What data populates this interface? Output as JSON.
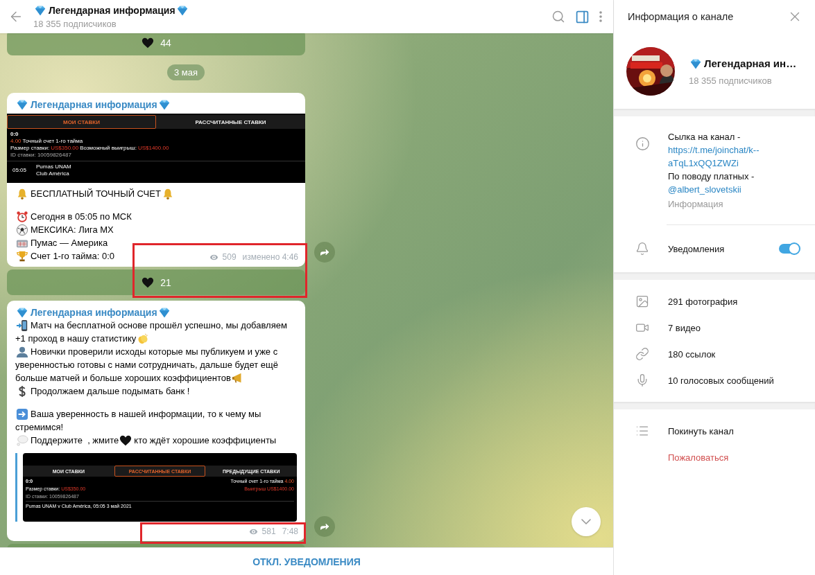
{
  "chat": {
    "title": "Легендарная информация",
    "subtitle": "18 355 подписчиков",
    "info_panel_selected": true,
    "items": [
      {
        "kind": "reactions",
        "count": "44"
      },
      {
        "kind": "date",
        "text": "3 мая"
      },
      {
        "kind": "message",
        "author": "Легендарная информация",
        "views": "509",
        "time": "изменено 4:46",
        "highlighted": true,
        "blocks": [
          {
            "kind": "screenshot",
            "tabs": [
              {
                "label": "МОИ СТАВКИ",
                "selected": true
              },
              {
                "label": "РАССЧИТАННЫЕ СТАВКИ",
                "selected": false
              }
            ],
            "score": "0:0",
            "odds": "4.00",
            "market": "Точный счет 1-го тайма",
            "stake_label": "Размер ставки:",
            "stake": "US$350.00",
            "payout_label": "Возможный выигрыш:",
            "payout": "US$1400.00",
            "bet_id": "ID ставки: 10059826487",
            "match_time": "05:05",
            "teams": [
              "Pumas UNAM",
              "Club América"
            ]
          },
          {
            "kind": "text",
            "lines": [
              {
                "parts": [
                  {
                    "kind": "emoji"
                  },
                  {
                    "kind": "text",
                    "text": "БЕСПЛАТНЫЙ ТОЧНЫЙ СЧЕТ"
                  },
                  {
                    "kind": "emoji"
                  }
                ]
              }
            ]
          },
          {
            "kind": "text",
            "lines": [
              {
                "parts": [
                  {
                    "kind": "emoji"
                  },
                  {
                    "kind": "text",
                    "text": "Сегодня в 05:05 по МСК"
                  }
                ]
              },
              {
                "parts": [
                  {
                    "kind": "emoji"
                  },
                  {
                    "kind": "text",
                    "text": "МЕКСИКА: Лига МХ"
                  }
                ]
              },
              {
                "parts": [
                  {
                    "kind": "emoji"
                  },
                  {
                    "kind": "text",
                    "text": "Пумас — Америка"
                  }
                ]
              },
              {
                "parts": [
                  {
                    "kind": "emoji"
                  },
                  {
                    "kind": "text",
                    "text": "Счет 1-го тайма: 0:0"
                  }
                ]
              }
            ]
          }
        ]
      },
      {
        "kind": "reactions",
        "count": "21"
      },
      {
        "kind": "message",
        "author": "Легендарная информация",
        "views": "581",
        "time": "7:48",
        "highlighted": true,
        "blocks": [
          {
            "kind": "text",
            "lines": [
              {
                "parts": [
                  {
                    "kind": "emoji"
                  },
                  {
                    "kind": "text",
                    "text": "Матч на бесплатной основе прошёл успешно, мы добавляем"
                  }
                ]
              },
              {
                "parts": [
                  {
                    "kind": "text",
                    "text": "+1 проход в нашу статистику"
                  },
                  {
                    "kind": "emoji"
                  }
                ]
              },
              {
                "parts": [
                  {
                    "kind": "emoji"
                  },
                  {
                    "kind": "text",
                    "text": "Новички проверили исходы которые мы публикуем и уже с"
                  }
                ]
              },
              {
                "parts": [
                  {
                    "kind": "text",
                    "text": "уверенностью готовы с нами сотрудничать, дальше будет ещё"
                  }
                ]
              },
              {
                "parts": [
                  {
                    "kind": "text",
                    "text": "больше матчей и больше хороших коэффициентов"
                  },
                  {
                    "kind": "emoji"
                  }
                ]
              },
              {
                "parts": [
                  {
                    "kind": "emoji"
                  },
                  {
                    "kind": "text",
                    "text": "Продолжаем дальше подымать банк !"
                  }
                ]
              }
            ]
          },
          {
            "kind": "text",
            "lines": [
              {
                "parts": [
                  {
                    "kind": "emoji"
                  },
                  {
                    "kind": "text",
                    "text": "Ваша уверенность в нашей информации, то к чему мы"
                  }
                ]
              },
              {
                "parts": [
                  {
                    "kind": "text",
                    "text": "стремимся!"
                  }
                ]
              },
              {
                "parts": [
                  {
                    "kind": "emoji"
                  },
                  {
                    "kind": "text",
                    "text": "Поддержите  , жмите"
                  },
                  {
                    "kind": "emoji"
                  },
                  {
                    "kind": "text",
                    "text": "кто ждёт хорошие коэффициенты"
                  }
                ]
              }
            ]
          },
          {
            "kind": "quoted_screenshot",
            "tabs": [
              {
                "label": "МОИ СТАВКИ",
                "selected": false
              },
              {
                "label": "РАССЧИТАННЫЕ СТАВКИ",
                "selected": true
              },
              {
                "label": "ПРЕДЫДУЩИЕ СТАВКИ",
                "selected": false
              }
            ],
            "score": "0:0",
            "stake_label": "Размер ставки:",
            "stake": "US$350.00",
            "bet_id": "ID ставки: 10059826487",
            "market": "Точный счет 1-го тайма",
            "odds": "4.00",
            "payout_label": "Выигрыш",
            "payout": "US$1400.00",
            "match": "Pumas UNAM v Club América, 05:05 3 май 2021"
          }
        ]
      },
      {
        "kind": "reactions"
      }
    ],
    "footer_button": "ОТКЛ. УВЕДОМЛЕНИЯ"
  },
  "info_panel": {
    "title": "Информация о канале",
    "name": "Легендарная ин…",
    "subscribers": "18 355 подписчиков",
    "description": [
      {
        "kind": "text",
        "text": "Сылка на канал -"
      },
      {
        "kind": "link",
        "text": "https://t.me/joinchat/k--aTqL1xQQ1ZWZi"
      },
      {
        "kind": "text",
        "text": "По поводу платных -"
      },
      {
        "kind": "link",
        "text": "@albert_slovetskii"
      }
    ],
    "description_label": "Информация",
    "notifications": {
      "label": "Уведомления",
      "on": true
    },
    "media": [
      {
        "kind": "photos",
        "label": "291 фотография"
      },
      {
        "kind": "videos",
        "label": "7 видео"
      },
      {
        "kind": "links",
        "label": "180 ссылок"
      },
      {
        "kind": "voice",
        "label": "10 голосовых сообщений"
      }
    ],
    "actions": [
      {
        "kind": "leave",
        "label": "Покинуть канал"
      },
      {
        "kind": "report",
        "label": "Пожаловаться"
      }
    ]
  }
}
